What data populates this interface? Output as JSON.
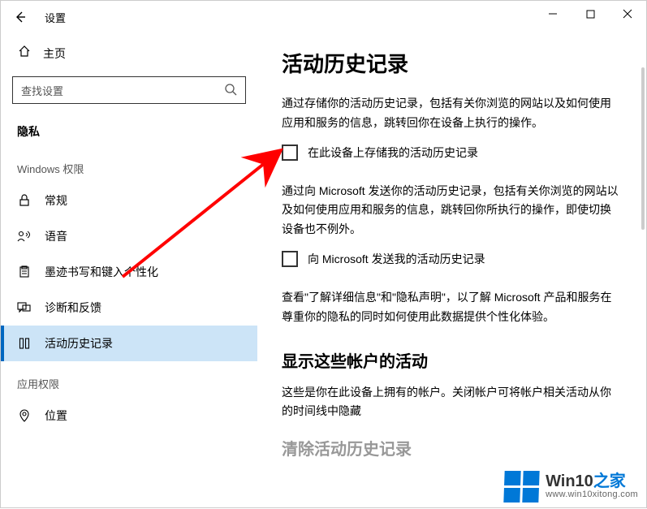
{
  "titlebar": {
    "title": "设置"
  },
  "sidebar": {
    "home": "主页",
    "search_placeholder": "查找设置",
    "category": "隐私",
    "section_windows": "Windows 权限",
    "section_app": "应用权限",
    "items": {
      "general": "常规",
      "speech": "语音",
      "ink": "墨迹书写和键入个性化",
      "diagnostics": "诊断和反馈",
      "activity": "活动历史记录",
      "location": "位置"
    }
  },
  "content": {
    "h1": "活动历史记录",
    "p1": "通过存储你的活动历史记录，包括有关你浏览的网站以及如何使用应用和服务的信息，跳转回你在设备上执行的操作。",
    "cb1": "在此设备上存储我的活动历史记录",
    "p2": "通过向 Microsoft 发送你的活动历史记录，包括有关你浏览的网站以及如何使用应用和服务的信息，跳转回你所执行的操作，即使切换设备也不例外。",
    "cb2": "向 Microsoft 发送我的活动历史记录",
    "p3": "查看\"了解详细信息\"和\"隐私声明\"，以了解 Microsoft 产品和服务在尊重你的隐私的同时如何使用此数据提供个性化体验。",
    "h2": "显示这些帐户的活动",
    "p4": "这些是你在此设备上拥有的帐户。关闭帐户可将帐户相关活动从你的时间线中隐藏",
    "h_cut": "清除活动历史记录"
  },
  "watermark": {
    "brand_a": "Win10",
    "brand_b": "之家",
    "url": "www.win10xitong.com"
  }
}
